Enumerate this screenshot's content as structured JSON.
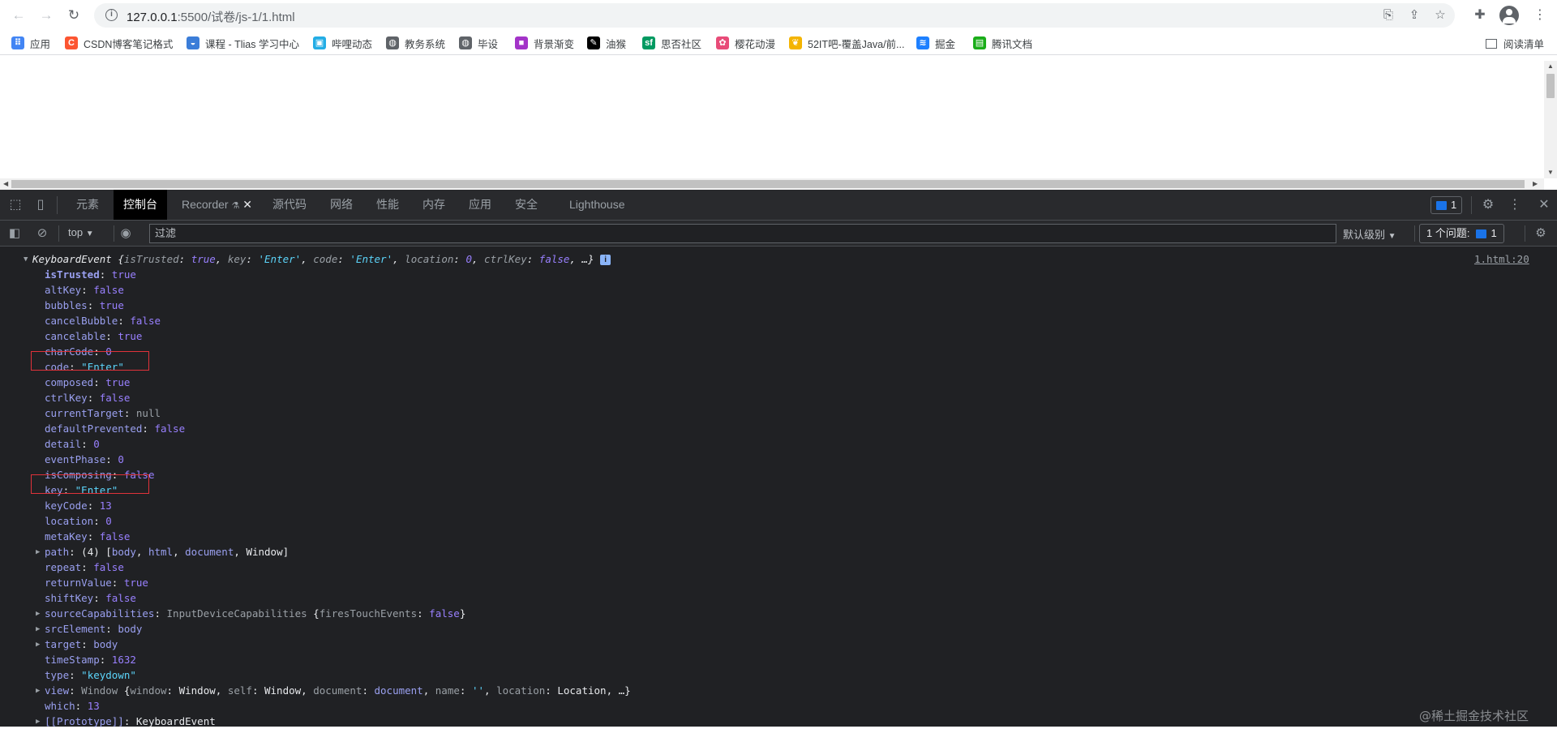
{
  "browser": {
    "url_host": "127.0.0.1",
    "url_rest": ":5500/试卷/js-1/1.html",
    "info_icon_glyph": "i"
  },
  "bookmarks": [
    {
      "label": "应用",
      "color": "#4285f4",
      "glyph": "⠿"
    },
    {
      "label": "CSDN博客笔记格式",
      "color": "#fc5531",
      "glyph": "C"
    },
    {
      "label": "课程 - Tlias 学习中心",
      "color": "#3b7dd8",
      "glyph": "◒"
    },
    {
      "label": "哔哩动态",
      "color": "#23ade5",
      "glyph": "▣"
    },
    {
      "label": "教务系统",
      "color": "#5f6368",
      "glyph": "◍"
    },
    {
      "label": "毕设",
      "color": "#5f6368",
      "glyph": "◍"
    },
    {
      "label": "背景渐变",
      "color": "#a333c8",
      "glyph": "■"
    },
    {
      "label": "油猴",
      "color": "#000000",
      "glyph": "✎"
    },
    {
      "label": "思否社区",
      "color": "#009a61",
      "glyph": "sf"
    },
    {
      "label": "樱花动漫",
      "color": "#e84b78",
      "glyph": "✿"
    },
    {
      "label": "52IT吧-覆盖Java/前...",
      "color": "#f4b400",
      "glyph": "❦"
    },
    {
      "label": "掘金",
      "color": "#1e80ff",
      "glyph": "≋"
    },
    {
      "label": "腾讯文档",
      "color": "#1aad19",
      "glyph": "▤"
    }
  ],
  "reading_list": "阅读清单",
  "devtools": {
    "tabs": [
      "元素",
      "控制台",
      "Recorder",
      "源代码",
      "网络",
      "性能",
      "内存",
      "应用",
      "安全",
      "Lighthouse"
    ],
    "active_tab": "控制台",
    "issues_badge": "1",
    "context": "top",
    "filter_placeholder": "过滤",
    "levels": "默认级别",
    "issues_label": "1 个问题:",
    "issues_count": "1"
  },
  "console": {
    "source_link": "1.html:20",
    "summary": {
      "type": "KeyboardEvent",
      "parts": [
        {
          "k": "isTrusted",
          "v": "true",
          "t": "bool"
        },
        {
          "k": "key",
          "v": "'Enter'",
          "t": "str"
        },
        {
          "k": "code",
          "v": "'Enter'",
          "t": "str"
        },
        {
          "k": "location",
          "v": "0",
          "t": "num"
        },
        {
          "k": "ctrlKey",
          "v": "false",
          "t": "bool"
        }
      ]
    },
    "properties": [
      {
        "k": "isTrusted",
        "v": "true",
        "t": "bool",
        "bold": true
      },
      {
        "k": "altKey",
        "v": "false",
        "t": "bool"
      },
      {
        "k": "bubbles",
        "v": "true",
        "t": "bool"
      },
      {
        "k": "cancelBubble",
        "v": "false",
        "t": "bool"
      },
      {
        "k": "cancelable",
        "v": "true",
        "t": "bool"
      },
      {
        "k": "charCode",
        "v": "0",
        "t": "num"
      },
      {
        "k": "code",
        "v": "\"Enter\"",
        "t": "str",
        "highlight": true
      },
      {
        "k": "composed",
        "v": "true",
        "t": "bool"
      },
      {
        "k": "ctrlKey",
        "v": "false",
        "t": "bool"
      },
      {
        "k": "currentTarget",
        "v": "null",
        "t": "dim"
      },
      {
        "k": "defaultPrevented",
        "v": "false",
        "t": "bool"
      },
      {
        "k": "detail",
        "v": "0",
        "t": "num"
      },
      {
        "k": "eventPhase",
        "v": "0",
        "t": "num"
      },
      {
        "k": "isComposing",
        "v": "false",
        "t": "bool"
      },
      {
        "k": "key",
        "v": "\"Enter\"",
        "t": "str",
        "highlight": true
      },
      {
        "k": "keyCode",
        "v": "13",
        "t": "num"
      },
      {
        "k": "location",
        "v": "0",
        "t": "num"
      },
      {
        "k": "metaKey",
        "v": "false",
        "t": "bool"
      },
      {
        "k": "path",
        "v": "(4) [",
        "t": "rich",
        "expand": true,
        "rich": [
          {
            "s": "(4) [",
            "c": "plain-dim"
          },
          {
            "s": "body",
            "c": "key"
          },
          {
            "s": ", ",
            "c": "plain"
          },
          {
            "s": "html",
            "c": "key"
          },
          {
            "s": ", ",
            "c": "plain"
          },
          {
            "s": "document",
            "c": "key"
          },
          {
            "s": ", ",
            "c": "plain"
          },
          {
            "s": "Window",
            "c": "plain"
          },
          {
            "s": "]",
            "c": "plain"
          }
        ]
      },
      {
        "k": "repeat",
        "v": "false",
        "t": "bool"
      },
      {
        "k": "returnValue",
        "v": "true",
        "t": "bool"
      },
      {
        "k": "shiftKey",
        "v": "false",
        "t": "bool"
      },
      {
        "k": "sourceCapabilities",
        "v": "",
        "t": "rich",
        "expand": true,
        "rich": [
          {
            "s": "InputDeviceCapabilities ",
            "c": "dim"
          },
          {
            "s": "{",
            "c": "plain"
          },
          {
            "s": "firesTouchEvents",
            "c": "dim"
          },
          {
            "s": ": ",
            "c": "plain"
          },
          {
            "s": "false",
            "c": "bool"
          },
          {
            "s": "}",
            "c": "plain"
          }
        ]
      },
      {
        "k": "srcElement",
        "v": "body",
        "t": "key",
        "expand": true
      },
      {
        "k": "target",
        "v": "body",
        "t": "key",
        "expand": true
      },
      {
        "k": "timeStamp",
        "v": "1632",
        "t": "num"
      },
      {
        "k": "type",
        "v": "\"keydown\"",
        "t": "str"
      },
      {
        "k": "view",
        "v": "",
        "t": "rich",
        "expand": true,
        "rich": [
          {
            "s": "Window ",
            "c": "dim"
          },
          {
            "s": "{",
            "c": "plain"
          },
          {
            "s": "window",
            "c": "dim"
          },
          {
            "s": ": ",
            "c": "plain"
          },
          {
            "s": "Window",
            "c": "plain"
          },
          {
            "s": ", ",
            "c": "plain"
          },
          {
            "s": "self",
            "c": "dim"
          },
          {
            "s": ": ",
            "c": "plain"
          },
          {
            "s": "Window",
            "c": "plain"
          },
          {
            "s": ", ",
            "c": "plain"
          },
          {
            "s": "document",
            "c": "dim"
          },
          {
            "s": ": ",
            "c": "plain"
          },
          {
            "s": "document",
            "c": "key"
          },
          {
            "s": ", ",
            "c": "plain"
          },
          {
            "s": "name",
            "c": "dim"
          },
          {
            "s": ": ",
            "c": "plain"
          },
          {
            "s": "''",
            "c": "str"
          },
          {
            "s": ", ",
            "c": "plain"
          },
          {
            "s": "location",
            "c": "dim"
          },
          {
            "s": ": ",
            "c": "plain"
          },
          {
            "s": "Location",
            "c": "plain"
          },
          {
            "s": ", …}",
            "c": "plain"
          }
        ]
      },
      {
        "k": "which",
        "v": "13",
        "t": "num"
      },
      {
        "k": "[[Prototype]]",
        "v": "KeyboardEvent",
        "t": "plain",
        "expand": true
      }
    ]
  },
  "watermark": "@稀土掘金技术社区"
}
